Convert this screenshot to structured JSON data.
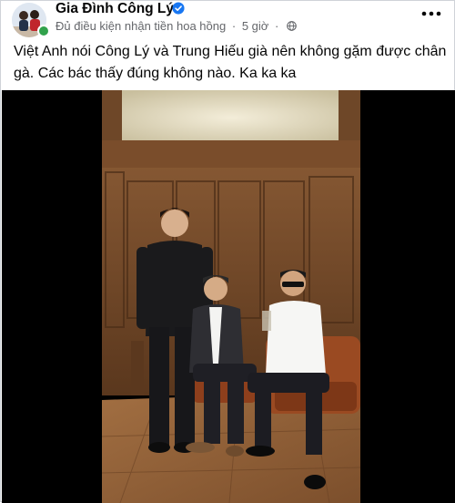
{
  "post": {
    "page_name": "Gia Đình Công Lý",
    "meta": {
      "subtitle": "Đủ điều kiện nhận tiền hoa hồng",
      "separator": "·",
      "time": "5 giờ",
      "privacy_icon": "globe-icon"
    },
    "caption": "Việt Anh nói Công Lý và Trung Hiếu già nên không gặm được chân gà. Các bác thấy đúng không nào. Ka ka ka"
  },
  "icons": {
    "verified": "verified-badge-icon",
    "more": "more-options-icon",
    "privacy": "globe-icon"
  },
  "colors": {
    "verified_blue": "#1877f2",
    "meta_gray": "#65676b",
    "online_green": "#31a24c",
    "media_background": "#000000"
  }
}
